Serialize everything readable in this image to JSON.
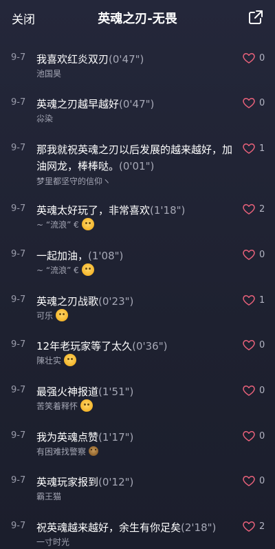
{
  "header": {
    "close_label": "关闭",
    "title": "英魂之刃-无畏"
  },
  "items": [
    {
      "date": "9-7",
      "text": "我喜欢红炎双刃",
      "duration": "(0'47\")",
      "user": "池国昊",
      "emoji": "",
      "likes": "0"
    },
    {
      "date": "9-7",
      "text": "英魂之刃越早越好",
      "duration": "(0'47\")",
      "user": "尛染",
      "emoji": "",
      "likes": "0"
    },
    {
      "date": "9-7",
      "text": "那我就祝英魂之刃以后发展的越来越好，加油网龙，棒棒哒。",
      "duration": "(0'01\")",
      "user": "梦里都坚守的信仰ヽ",
      "emoji": "",
      "likes": "1"
    },
    {
      "date": "9-7",
      "text": "英魂太好玩了，非常喜欢",
      "duration": "(1'18\")",
      "user": "~ “流浪” €",
      "emoji": "smile",
      "likes": "2"
    },
    {
      "date": "9-7",
      "text": "一起加油，",
      "duration": "(1'08\")",
      "user": "~ “流浪” €",
      "emoji": "smile",
      "likes": "0"
    },
    {
      "date": "9-7",
      "text": "英魂之刃战歌",
      "duration": "(0'23\")",
      "user": "可乐",
      "emoji": "smile",
      "likes": "1"
    },
    {
      "date": "9-7",
      "text": "12年老玩家等了太久",
      "duration": "(0'36\")",
      "user": "陳壮实",
      "emoji": "smile",
      "likes": "0"
    },
    {
      "date": "9-7",
      "text": "最强火神报道",
      "duration": "(1'51\")",
      "user": "苦笑着释怀",
      "emoji": "smile",
      "likes": "0"
    },
    {
      "date": "9-7",
      "text": "我为英魂点赞",
      "duration": "(1'17\")",
      "user": "有困难找警察",
      "emoji": "face",
      "likes": "0"
    },
    {
      "date": "9-7",
      "text": "英魂玩家报到",
      "duration": "(0'12\")",
      "user": "霸王猫",
      "emoji": "",
      "likes": "0"
    },
    {
      "date": "9-7",
      "text": "祝英魂越来越好，余生有你足矣",
      "duration": "(2'18\")",
      "user": "一寸时光",
      "emoji": "",
      "likes": "2"
    }
  ],
  "colors": {
    "background": "#1f2232",
    "heart": "#e8617a",
    "secondary_text": "#a4a6b4"
  },
  "icons": {
    "share": "share-external-icon",
    "like": "heart-outline-icon"
  }
}
